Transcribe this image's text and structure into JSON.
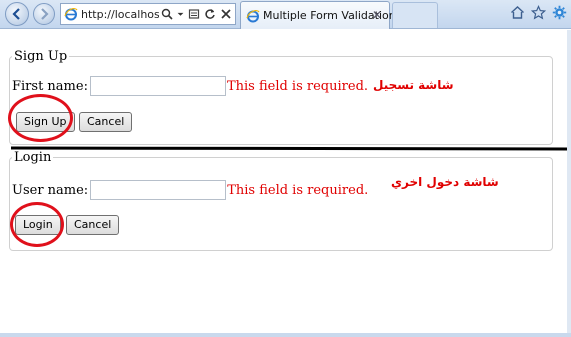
{
  "browser": {
    "address_text": "http://localhost:",
    "tab_title": "Multiple Form Validation",
    "tab_close_glyph": "✕"
  },
  "signup": {
    "legend": "Sign Up",
    "field_label": "First name:",
    "field_value": "",
    "error": "This field is required.",
    "submit_label": "Sign Up",
    "cancel_label": "Cancel",
    "annotation": "شاشة تسجيل"
  },
  "login": {
    "legend": "Login",
    "field_label": "User name:",
    "field_value": "",
    "error": "This field is required.",
    "submit_label": "Login",
    "cancel_label": "Cancel",
    "annotation": "شاشة دخول اخري"
  },
  "colors": {
    "error": "#e00000",
    "annotation_circle": "#e0101b",
    "chrome": "#c3d6ee"
  },
  "icons": [
    "back-arrow-icon",
    "forward-arrow-icon",
    "ie-logo-icon",
    "search-icon",
    "refresh-icon",
    "stop-icon",
    "home-icon",
    "favorites-star-icon",
    "gear-icon"
  ]
}
